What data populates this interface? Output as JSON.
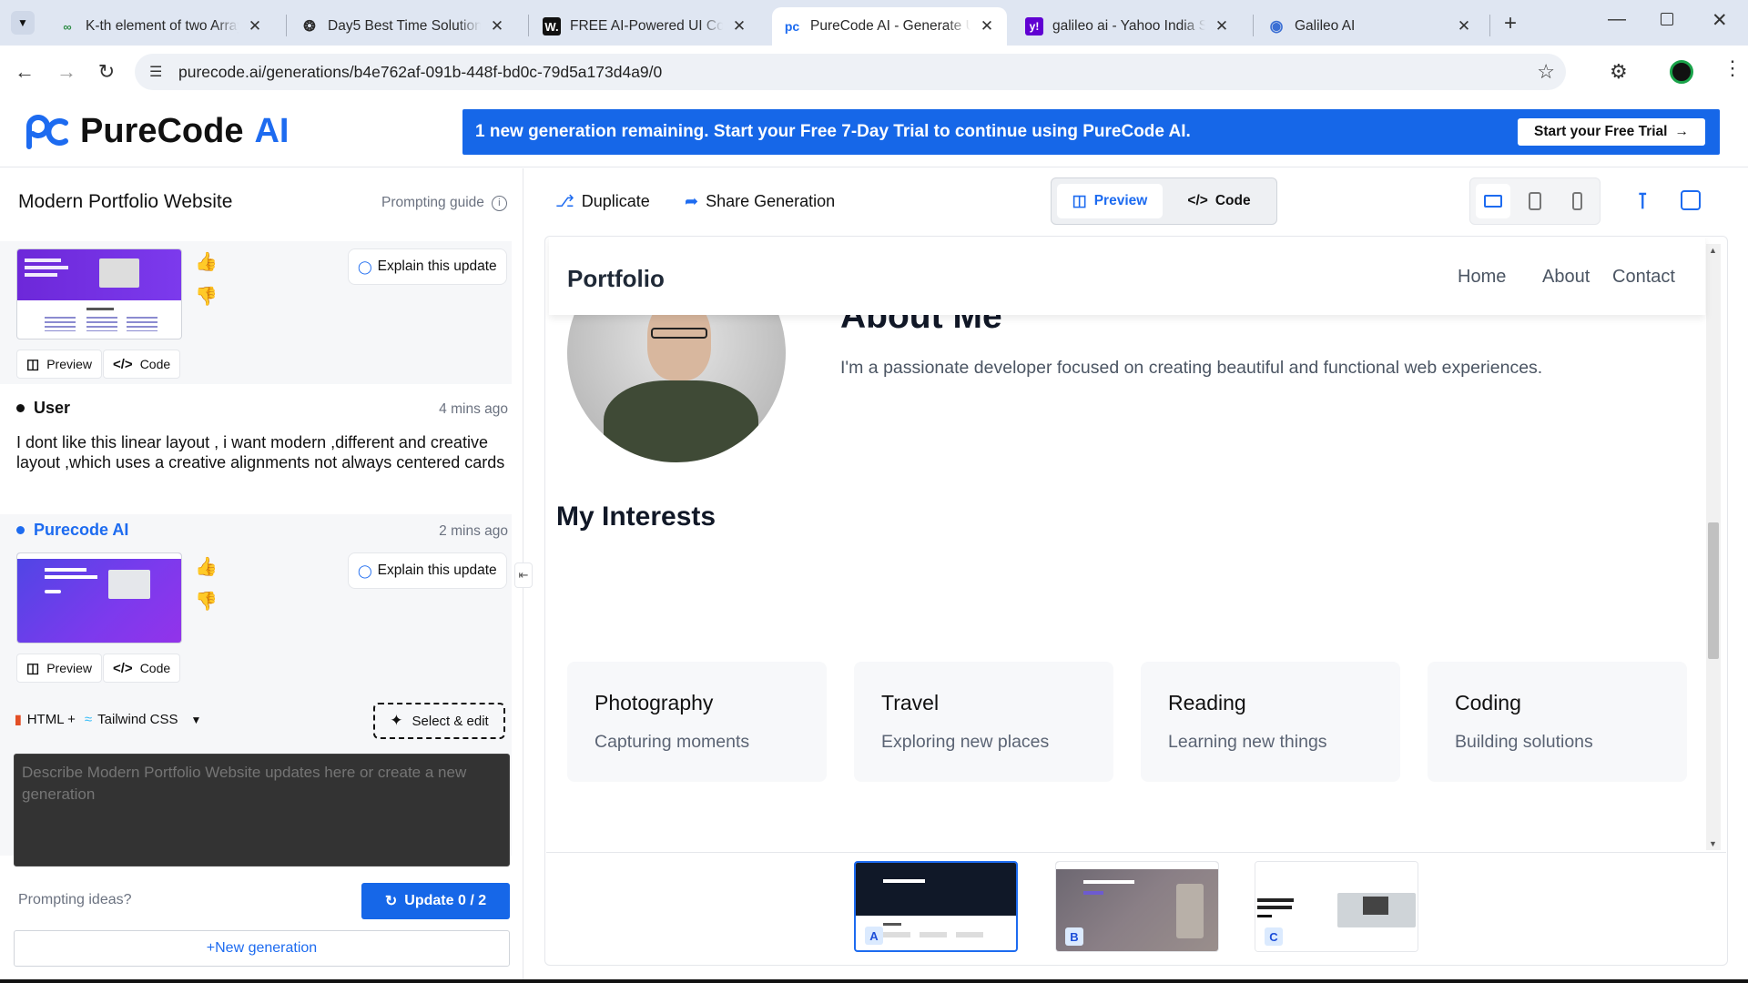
{
  "browser": {
    "tabs": [
      {
        "title": "K-th element of two Arrays",
        "icon": "gfg-icon"
      },
      {
        "title": "Day5 Best Time Solution",
        "icon": "openai-icon"
      },
      {
        "title": "FREE AI-Powered UI Code G",
        "icon": "w-icon"
      },
      {
        "title": "PureCode AI - Generate UI",
        "icon": "purecode-icon"
      },
      {
        "title": "galileo ai - Yahoo India Sea",
        "icon": "yahoo-icon"
      },
      {
        "title": "Galileo AI",
        "icon": "galileo-icon"
      }
    ],
    "url": "purecode.ai/generations/b4e762af-091b-448f-bd0c-79d5a173d4a9/0"
  },
  "header": {
    "logo_brand": "PureCode",
    "logo_ai": "AI",
    "banner_text": "1 new generation remaining. Start your Free 7-Day Trial to continue using PureCode AI.",
    "trial_button": "Start your Free Trial"
  },
  "left": {
    "title": "Modern Portfolio Website",
    "prompting_guide": "Prompting guide",
    "card1": {
      "explain": "Explain this update",
      "preview": "Preview",
      "code": "Code"
    },
    "user_msg": {
      "author": "User",
      "time": "4 mins ago",
      "text": "I dont like this linear layout , i want modern ,different and creative layout ,which uses a creative alignments not always centered cards"
    },
    "ai_msg": {
      "author": "Purecode AI",
      "time": "2 mins ago",
      "explain": "Explain this update",
      "preview": "Preview",
      "code": "Code"
    },
    "stack_html": "HTML +",
    "stack_tailwind": "Tailwind CSS",
    "select_edit": "Select & edit",
    "prompt_placeholder": "Describe Modern Portfolio Website updates here or create a new generation",
    "prompting_ideas": "Prompting ideas?",
    "update_button": "Update 0 / 2",
    "new_generation": "+New generation"
  },
  "toolbar": {
    "duplicate": "Duplicate",
    "share": "Share Generation",
    "preview_tab": "Preview",
    "code_tab": "Code"
  },
  "preview": {
    "brand": "Portfolio",
    "nav": [
      "Home",
      "About",
      "Contact"
    ],
    "about_title": "About Me",
    "about_text": "I'm a passionate developer focused on creating beautiful and functional web experiences.",
    "interests_title": "My Interests",
    "interests": [
      {
        "title": "Photography",
        "desc": "Capturing moments"
      },
      {
        "title": "Travel",
        "desc": "Exploring new places"
      },
      {
        "title": "Reading",
        "desc": "Learning new things"
      },
      {
        "title": "Coding",
        "desc": "Building solutions"
      }
    ]
  },
  "variants": [
    "A",
    "B",
    "C"
  ]
}
